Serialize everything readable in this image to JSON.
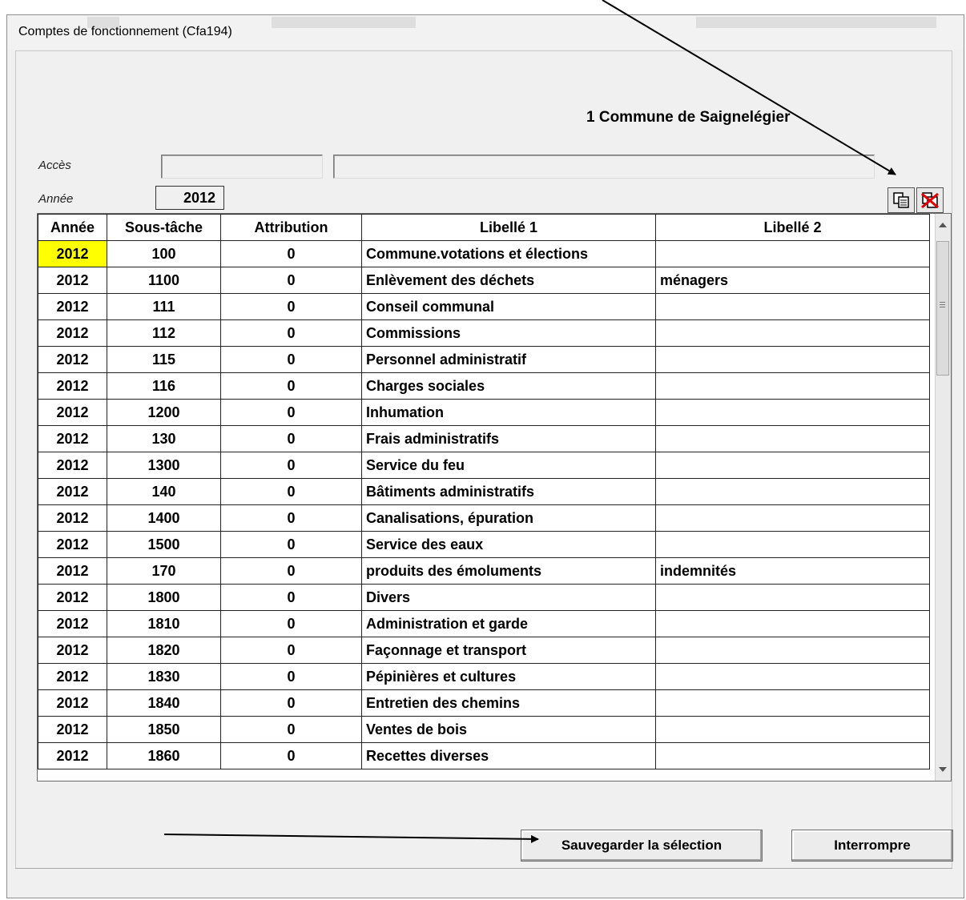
{
  "window": {
    "title": "Comptes de fonctionnement (Cfa194)",
    "commune": "1  Commune de Saignelégier"
  },
  "form": {
    "acces_label": "Accès",
    "annee_label": "Année",
    "annee_value": "2012",
    "acces_code": "",
    "acces_text": ""
  },
  "toolbar": {
    "copy_icon": "copy-selection-icon",
    "delete_icon": "delete-selection-icon"
  },
  "table": {
    "columns": [
      "Année",
      "Sous-tâche",
      "Attribution",
      "Libellé 1",
      "Libellé 2"
    ],
    "rows": [
      {
        "annee": "2012",
        "sous_tache": "100",
        "attribution": "0",
        "libelle1": "Commune.votations et élections",
        "libelle2": ""
      },
      {
        "annee": "2012",
        "sous_tache": "1100",
        "attribution": "0",
        "libelle1": "Enlèvement des déchets",
        "libelle2": "ménagers"
      },
      {
        "annee": "2012",
        "sous_tache": "111",
        "attribution": "0",
        "libelle1": "Conseil communal",
        "libelle2": ""
      },
      {
        "annee": "2012",
        "sous_tache": "112",
        "attribution": "0",
        "libelle1": "Commissions",
        "libelle2": ""
      },
      {
        "annee": "2012",
        "sous_tache": "115",
        "attribution": "0",
        "libelle1": "Personnel administratif",
        "libelle2": ""
      },
      {
        "annee": "2012",
        "sous_tache": "116",
        "attribution": "0",
        "libelle1": "Charges sociales",
        "libelle2": ""
      },
      {
        "annee": "2012",
        "sous_tache": "1200",
        "attribution": "0",
        "libelle1": "Inhumation",
        "libelle2": ""
      },
      {
        "annee": "2012",
        "sous_tache": "130",
        "attribution": "0",
        "libelle1": "Frais administratifs",
        "libelle2": ""
      },
      {
        "annee": "2012",
        "sous_tache": "1300",
        "attribution": "0",
        "libelle1": "Service du feu",
        "libelle2": ""
      },
      {
        "annee": "2012",
        "sous_tache": "140",
        "attribution": "0",
        "libelle1": "Bâtiments administratifs",
        "libelle2": ""
      },
      {
        "annee": "2012",
        "sous_tache": "1400",
        "attribution": "0",
        "libelle1": "Canalisations, épuration",
        "libelle2": ""
      },
      {
        "annee": "2012",
        "sous_tache": "1500",
        "attribution": "0",
        "libelle1": "Service des eaux",
        "libelle2": ""
      },
      {
        "annee": "2012",
        "sous_tache": "170",
        "attribution": "0",
        "libelle1": "produits des émoluments",
        "libelle2": "indemnités"
      },
      {
        "annee": "2012",
        "sous_tache": "1800",
        "attribution": "0",
        "libelle1": "Divers",
        "libelle2": ""
      },
      {
        "annee": "2012",
        "sous_tache": "1810",
        "attribution": "0",
        "libelle1": "Administration et garde",
        "libelle2": ""
      },
      {
        "annee": "2012",
        "sous_tache": "1820",
        "attribution": "0",
        "libelle1": "Façonnage et transport",
        "libelle2": ""
      },
      {
        "annee": "2012",
        "sous_tache": "1830",
        "attribution": "0",
        "libelle1": "Pépinières et cultures",
        "libelle2": ""
      },
      {
        "annee": "2012",
        "sous_tache": "1840",
        "attribution": "0",
        "libelle1": "Entretien des chemins",
        "libelle2": ""
      },
      {
        "annee": "2012",
        "sous_tache": "1850",
        "attribution": "0",
        "libelle1": "Ventes de bois",
        "libelle2": ""
      },
      {
        "annee": "2012",
        "sous_tache": "1860",
        "attribution": "0",
        "libelle1": "Recettes diverses",
        "libelle2": ""
      }
    ]
  },
  "buttons": {
    "save": "Sauvegarder la sélection",
    "cancel": "Interrompre"
  },
  "colors": {
    "selected_cell": "#ffff00",
    "window_bg": "#f0f0f0",
    "arrow": "#000000"
  }
}
